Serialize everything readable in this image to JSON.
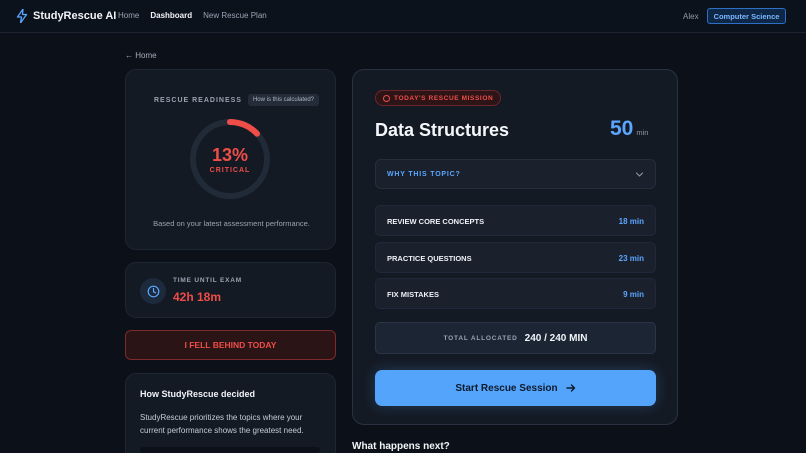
{
  "colors": {
    "accent_blue": "#5aa6ff",
    "critical_red": "#ef4d48",
    "background": "#0b1019",
    "card": "#141a24"
  },
  "header": {
    "brand": "StudyRescue AI",
    "brand_icon": "lightning-icon",
    "nav": [
      "Home",
      "Dashboard",
      "New Rescue Plan"
    ],
    "active_nav": "Dashboard",
    "user": "Alex",
    "subject": "Computer Science"
  },
  "breadcrumb": {
    "back_label": "← Home"
  },
  "readiness": {
    "title": "RESCUE READINESS",
    "calc_link": "How is this calculated?",
    "percent_value": 13,
    "percent_label": "13%",
    "status": "CRITICAL",
    "note": "Based on your latest assessment performance."
  },
  "exam": {
    "icon": "clock-icon",
    "label": "TIME UNTIL EXAM",
    "value": "42h 18m"
  },
  "behind_button": "I FELL BEHIND TODAY",
  "decided": {
    "title": "How StudyRescue decided",
    "body": "StudyRescue prioritizes the topics where your current performance shows the greatest need."
  },
  "mission": {
    "badge": "TODAY'S RESCUE MISSION",
    "topic": "Data Structures",
    "minutes": "50",
    "unit": "min",
    "why_label": "WHY THIS TOPIC?",
    "tasks": [
      {
        "name": "REVIEW CORE CONCEPTS",
        "time": "18 min"
      },
      {
        "name": "PRACTICE QUESTIONS",
        "time": "23 min"
      },
      {
        "name": "FIX MISTAKES",
        "time": "9 min"
      }
    ],
    "total_label": "TOTAL ALLOCATED",
    "total_value": "240 / 240 MIN",
    "start_label": "Start Rescue Session"
  },
  "next_title": "What happens next?"
}
